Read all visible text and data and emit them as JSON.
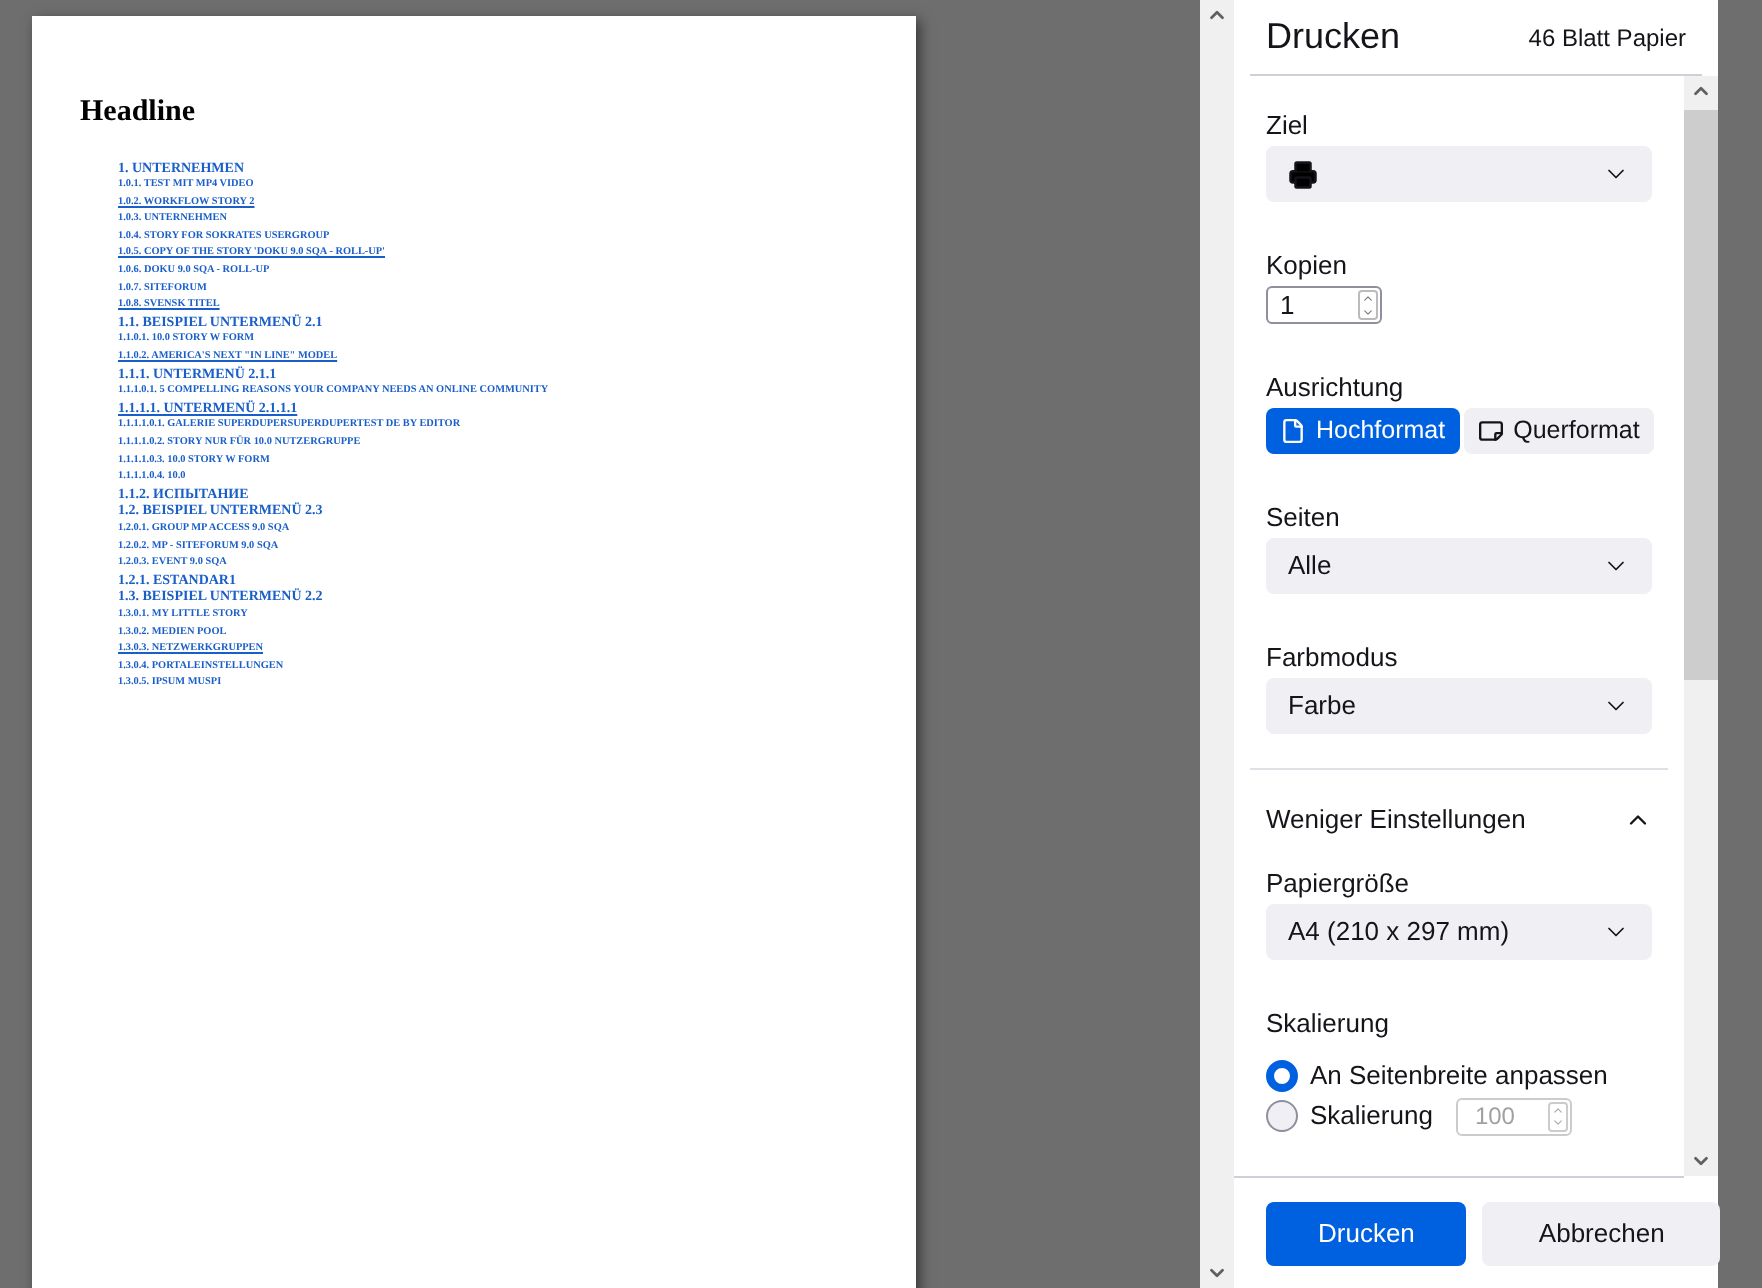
{
  "preview": {
    "headline": "Headline",
    "toc": [
      {
        "kind": "heading",
        "text": "1. UNTERNEHMEN",
        "underlined": false
      },
      {
        "kind": "item",
        "text": "1.0.1. TEST MIT MP4 VIDEO",
        "underlined": false
      },
      {
        "kind": "item",
        "text": "1.0.2. WORKFLOW STORY 2",
        "underlined": true
      },
      {
        "kind": "item",
        "text": "1.0.3. UNTERNEHMEN",
        "underlined": false
      },
      {
        "kind": "item",
        "text": "1.0.4. STORY FOR SOKRATES USERGROUP",
        "underlined": false
      },
      {
        "kind": "item",
        "text": "1.0.5. COPY OF THE STORY 'DOKU 9.0 SQA - ROLL-UP'",
        "underlined": true
      },
      {
        "kind": "item",
        "text": "1.0.6. DOKU 9.0 SQA - ROLL-UP",
        "underlined": false
      },
      {
        "kind": "item",
        "text": "1.0.7. SITEFORUM",
        "underlined": false
      },
      {
        "kind": "item",
        "text": "1.0.8. SVENSK TITEL",
        "underlined": true
      },
      {
        "kind": "heading",
        "text": "1.1. BEISPIEL UNTERMENÜ 2.1",
        "underlined": false
      },
      {
        "kind": "item",
        "text": "1.1.0.1. 10.0 STORY W FORM",
        "underlined": false
      },
      {
        "kind": "item",
        "text": "1.1.0.2. AMERICA'S NEXT \"IN LINE\" MODEL",
        "underlined": true
      },
      {
        "kind": "heading",
        "text": "1.1.1. UNTERMENÜ 2.1.1",
        "underlined": false
      },
      {
        "kind": "item",
        "text": "1.1.1.0.1. 5 COMPELLING REASONS YOUR COMPANY NEEDS AN ONLINE COMMUNITY",
        "underlined": false
      },
      {
        "kind": "heading",
        "text": "1.1.1.1. UNTERMENÜ 2.1.1.1",
        "underlined": true
      },
      {
        "kind": "item",
        "text": "1.1.1.1.0.1. GALERIE SUPERDUPERSUPERDUPERTEST DE BY EDITOR",
        "underlined": false
      },
      {
        "kind": "item",
        "text": "1.1.1.1.0.2. STORY NUR FÜR 10.0 NUTZERGRUPPE",
        "underlined": false
      },
      {
        "kind": "item",
        "text": "1.1.1.1.0.3. 10.0 STORY W FORM",
        "underlined": false
      },
      {
        "kind": "item",
        "text": "1.1.1.1.0.4. 10.0",
        "underlined": false
      },
      {
        "kind": "heading",
        "text": "1.1.2. ИСПЫТАНИЕ",
        "underlined": false
      },
      {
        "kind": "heading",
        "text": "1.2. BEISPIEL UNTERMENÜ 2.3",
        "underlined": false
      },
      {
        "kind": "item",
        "text": "1.2.0.1. GROUP MP ACCESS 9.0 SQA",
        "underlined": false
      },
      {
        "kind": "item",
        "text": "1.2.0.2. MP - SITEFORUM 9.0 SQA",
        "underlined": false
      },
      {
        "kind": "item",
        "text": "1.2.0.3. EVENT 9.0 SQA",
        "underlined": false
      },
      {
        "kind": "heading",
        "text": "1.2.1. ESTANDAR1",
        "underlined": false
      },
      {
        "kind": "heading",
        "text": "1.3. BEISPIEL UNTERMENÜ 2.2",
        "underlined": false
      },
      {
        "kind": "item",
        "text": "1.3.0.1. MY LITTLE STORY",
        "underlined": false
      },
      {
        "kind": "item",
        "text": "1.3.0.2. MEDIEN POOL",
        "underlined": false
      },
      {
        "kind": "item",
        "text": "1.3.0.3. NETZWERKGRUPPEN",
        "underlined": true
      },
      {
        "kind": "item",
        "text": "1.3.0.4. PORTALEINSTELLUNGEN",
        "underlined": false
      },
      {
        "kind": "item",
        "text": "1.3.0.5. IPSUM MUSPI",
        "underlined": false
      }
    ]
  },
  "panel": {
    "title": "Drucken",
    "sheet_count": "46 Blatt Papier",
    "destination": {
      "label": "Ziel"
    },
    "copies": {
      "label": "Kopien",
      "value": "1"
    },
    "orientation": {
      "label": "Ausrichtung",
      "options": [
        {
          "kind": "portrait",
          "label": "Hochformat",
          "selected": true
        },
        {
          "kind": "landscape",
          "label": "Querformat",
          "selected": false
        }
      ]
    },
    "pages": {
      "label": "Seiten",
      "value": "Alle"
    },
    "color_mode": {
      "label": "Farbmodus",
      "value": "Farbe"
    },
    "more_settings": {
      "label": "Weniger Einstellungen",
      "expanded": true
    },
    "paper_size": {
      "label": "Papiergröße",
      "value": "A4 (210 x 297 mm)"
    },
    "scaling": {
      "label": "Skalierung",
      "options": [
        {
          "label": "An Seitenbreite anpassen",
          "selected": true
        },
        {
          "label": "Skalierung",
          "selected": false,
          "value": "100"
        }
      ]
    },
    "buttons": [
      {
        "kind": "primary",
        "label": "Drucken"
      },
      {
        "kind": "secondary",
        "label": "Abbrechen"
      }
    ]
  }
}
